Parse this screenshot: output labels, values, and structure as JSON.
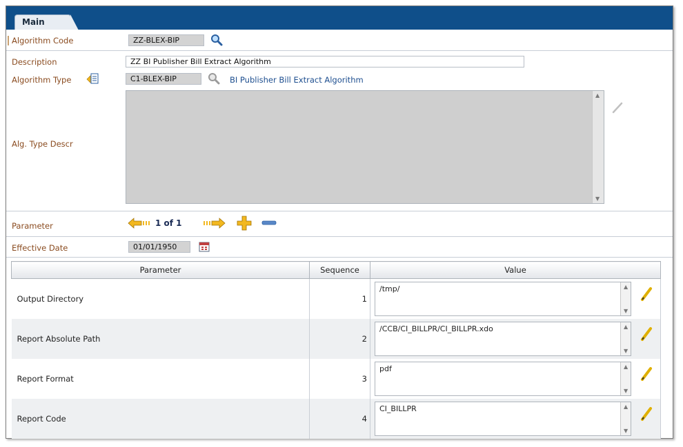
{
  "tabs": [
    {
      "label": "Main"
    }
  ],
  "algorithm_code": {
    "label": "Algorithm Code",
    "value": "ZZ-BLEX-BIP"
  },
  "description": {
    "label": "Description",
    "value": "ZZ BI Publisher Bill Extract Algorithm"
  },
  "algorithm_type": {
    "label": "Algorithm Type",
    "value": "C1-BLEX-BIP",
    "link": "BI Publisher Bill Extract Algorithm"
  },
  "alg_type_descr": {
    "label": "Alg. Type Descr",
    "value": ""
  },
  "parameter_nav": {
    "label": "Parameter",
    "page_text": "1 of 1"
  },
  "effective_date": {
    "label": "Effective Date",
    "value": "01/01/1950"
  },
  "grid": {
    "headers": [
      "Parameter",
      "Sequence",
      "Value"
    ],
    "rows": [
      {
        "parameter": "Output Directory",
        "sequence": "1",
        "value": "/tmp/"
      },
      {
        "parameter": "Report Absolute Path",
        "sequence": "2",
        "value": "/CCB/CI_BILLPR/CI_BILLPR.xdo"
      },
      {
        "parameter": "Report Format",
        "sequence": "3",
        "value": "pdf"
      },
      {
        "parameter": "Report Code",
        "sequence": "4",
        "value": "CI_BILLPR"
      }
    ]
  },
  "colors": {
    "tab_bar": "#0f4f8a",
    "label": "#8a4b1f",
    "link": "#1d4e8f",
    "arrow": "#f2b820"
  },
  "icons": [
    "search-icon",
    "search-icon-disabled",
    "algorithm-type-context-icon",
    "edit-pencil-icon",
    "prev-page-icon",
    "next-page-icon",
    "add-row-icon",
    "remove-row-icon",
    "calendar-icon"
  ]
}
